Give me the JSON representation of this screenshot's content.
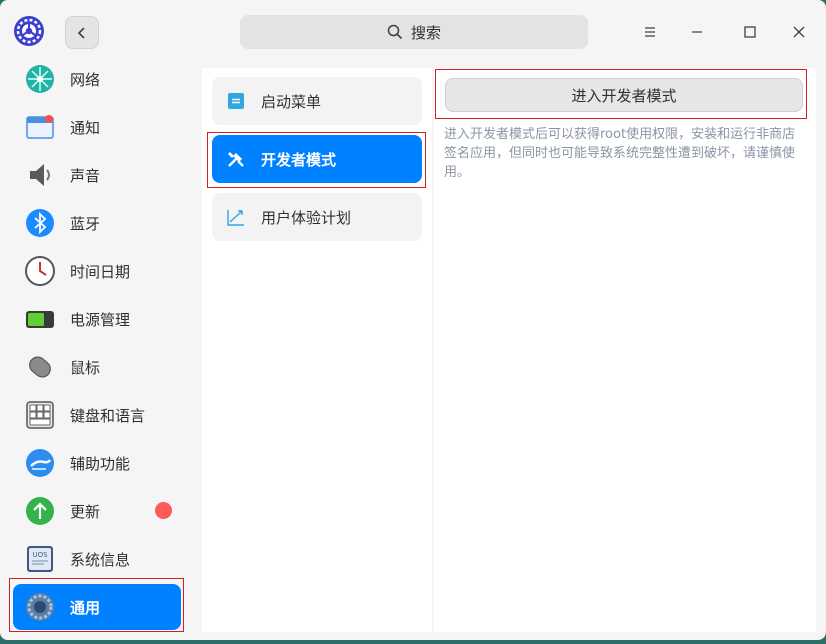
{
  "search": {
    "label": "搜索"
  },
  "sidebar": {
    "items": [
      {
        "label": "网络",
        "icon": "network-icon"
      },
      {
        "label": "通知",
        "icon": "notification-icon"
      },
      {
        "label": "声音",
        "icon": "speaker-icon"
      },
      {
        "label": "蓝牙",
        "icon": "bluetooth-icon"
      },
      {
        "label": "时间日期",
        "icon": "clock-icon"
      },
      {
        "label": "电源管理",
        "icon": "battery-icon"
      },
      {
        "label": "鼠标",
        "icon": "mouse-icon"
      },
      {
        "label": "键盘和语言",
        "icon": "keyboard-icon"
      },
      {
        "label": "辅助功能",
        "icon": "accessibility-icon"
      },
      {
        "label": "更新",
        "icon": "update-icon"
      },
      {
        "label": "系统信息",
        "icon": "system-info-icon",
        "icon_text": "UOS"
      },
      {
        "label": "通用",
        "icon": "general-gear-icon",
        "active": true
      }
    ]
  },
  "middle": {
    "items": [
      {
        "label": "启动菜单",
        "icon": "boot-menu-icon"
      },
      {
        "label": "开发者模式",
        "icon": "tools-icon",
        "active": true
      },
      {
        "label": "用户体验计划",
        "icon": "chart-trend-icon"
      }
    ]
  },
  "content": {
    "button_label": "进入开发者模式",
    "description": "进入开发者模式后可以获得root使用权限，安装和运行非商店签名应用，但同时也可能导致系统完整性遭到破坏，请谨慎使用。"
  },
  "colors": {
    "accent": "#0081ff",
    "badge": "#ff5a5a",
    "highlight": "#d22020"
  }
}
